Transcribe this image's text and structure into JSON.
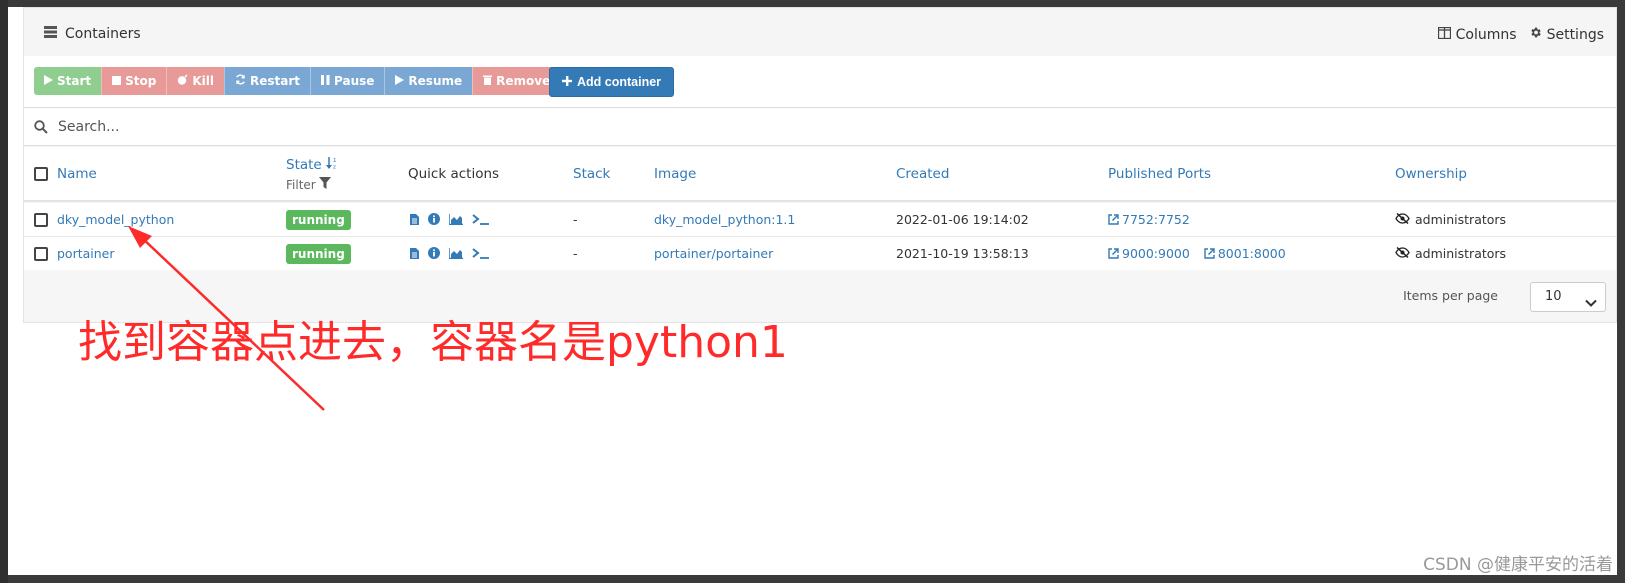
{
  "widget": {
    "title": "Containers",
    "columns_label": "Columns",
    "settings_label": "Settings"
  },
  "toolbar": {
    "start": "Start",
    "stop": "Stop",
    "kill": "Kill",
    "restart": "Restart",
    "pause": "Pause",
    "resume": "Resume",
    "remove": "Remove",
    "add": "Add container"
  },
  "search": {
    "placeholder": "Search..."
  },
  "table": {
    "headers": {
      "name": "Name",
      "state": "State",
      "state_filter": "Filter",
      "quick_actions": "Quick actions",
      "stack": "Stack",
      "image": "Image",
      "created": "Created",
      "ports": "Published Ports",
      "ownership": "Ownership"
    },
    "rows": [
      {
        "name": "dky_model_python",
        "state": "running",
        "stack": "-",
        "image": "dky_model_python:1.1",
        "created": "2022-01-06 19:14:02",
        "ports": [
          "7752:7752"
        ],
        "ownership": "administrators"
      },
      {
        "name": "portainer",
        "state": "running",
        "stack": "-",
        "image": "portainer/portainer",
        "created": "2021-10-19 13:58:13",
        "ports": [
          "9000:9000",
          "8001:8000"
        ],
        "ownership": "administrators"
      }
    ]
  },
  "pagination": {
    "items_per_page_label": "Items per page",
    "items_per_page_value": "10"
  },
  "annotation": {
    "text": "找到容器点进去，容器名是python1"
  },
  "watermark": "CSDN @健康平安的活着",
  "colors": {
    "primary": "#337ab7",
    "running": "#5cb85c",
    "annotation": "#ff2a2a"
  }
}
